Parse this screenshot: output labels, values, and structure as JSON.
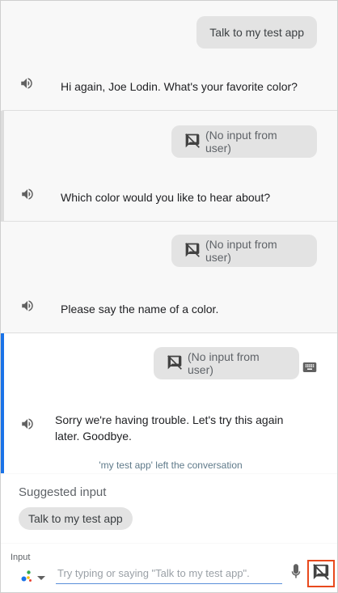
{
  "conversation": {
    "turns": [
      {
        "user_text": "Talk to my test app",
        "response": "Hi again, Joe Lodin. What's your favorite color?"
      },
      {
        "user_text": "(No input from user)",
        "response": "Which color would you like to hear about?"
      },
      {
        "user_text": "(No input from user)",
        "response": "Please say the name of a color."
      },
      {
        "user_text": "(No input from user)",
        "response": "Sorry we're having trouble. Let's try this again later. Goodbye.",
        "note": "'my test app' left the conversation"
      }
    ]
  },
  "suggested": {
    "title": "Suggested input",
    "chips": [
      "Talk to my test app"
    ]
  },
  "input": {
    "label": "Input",
    "placeholder": "Try typing or saying \"Talk to my test app\"."
  },
  "colors": {
    "accent": "#1a73e8",
    "highlight_border": "#e8491d",
    "bubble": "#e3e3e3"
  },
  "icons": {
    "speaker": "speaker-icon",
    "no_input": "no-input-icon",
    "keyboard": "keyboard-icon",
    "mic": "mic-icon",
    "assistant": "assistant-dots-icon",
    "dropdown": "dropdown-arrow-icon"
  }
}
